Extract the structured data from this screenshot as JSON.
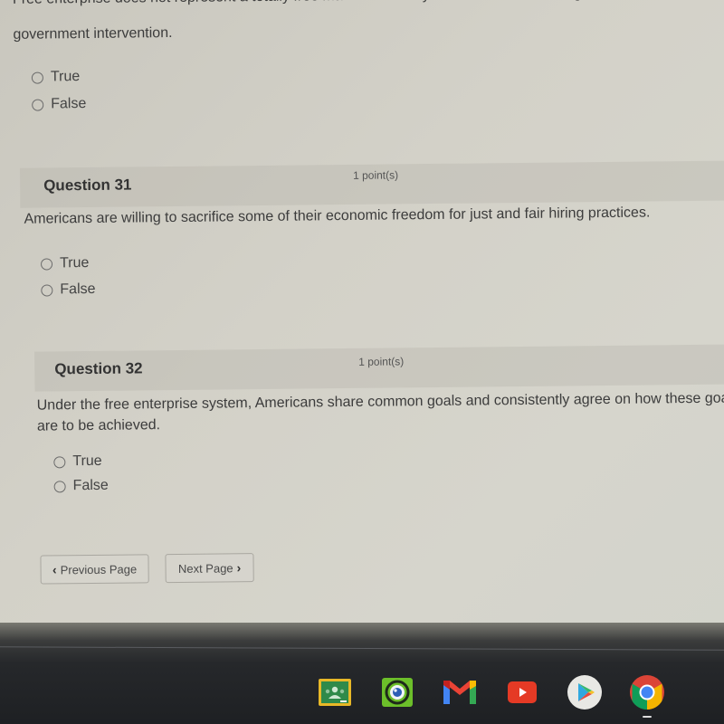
{
  "questions": [
    {
      "number_label": "",
      "points_label": "",
      "text_lines": [
        "Free enterprise does not represent a totally free market economy because it includes regulation and",
        "government intervention."
      ],
      "options": [
        "True",
        "False"
      ]
    },
    {
      "number_label": "Question 31",
      "points_label": "1 point(s)",
      "text_lines": [
        "Americans are willing to sacrifice some of their economic freedom for just and fair hiring practices."
      ],
      "options": [
        "True",
        "False"
      ]
    },
    {
      "number_label": "Question 32",
      "points_label": "1 point(s)",
      "text_lines": [
        "Under the free enterprise system, Americans share common goals and consistently agree on how these goals",
        "are to be achieved."
      ],
      "options": [
        "True",
        "False"
      ]
    }
  ],
  "navigation": {
    "previous_label": "Previous Page",
    "next_label": "Next Page",
    "previous_icon": "chevron-left-icon",
    "next_icon": "chevron-right-icon"
  },
  "shelf": {
    "apps": [
      {
        "name": "Google Classroom",
        "icon": "google-classroom-icon"
      },
      {
        "name": "Camera",
        "icon": "camera-app-icon"
      },
      {
        "name": "Gmail",
        "icon": "gmail-icon"
      },
      {
        "name": "YouTube",
        "icon": "youtube-icon"
      },
      {
        "name": "Play Store",
        "icon": "play-store-icon"
      },
      {
        "name": "Chrome",
        "icon": "chrome-icon",
        "running": true
      }
    ]
  },
  "colors": {
    "page_background": "#d3d1c8",
    "text": "#3c3c3c",
    "header_band": "#c4c2b9",
    "shelf_background": "#1e2023"
  }
}
